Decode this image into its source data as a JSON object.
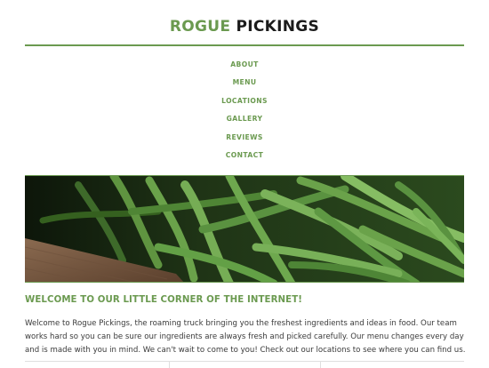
{
  "site": {
    "logo_accent": "ROGUE",
    "logo_rest": " PICKINGS",
    "accent_color": "#6b9a50"
  },
  "nav": {
    "items": [
      {
        "label": "ABOUT"
      },
      {
        "label": "MENU"
      },
      {
        "label": "LOCATIONS"
      },
      {
        "label": "GALLERY"
      },
      {
        "label": "REVIEWS"
      },
      {
        "label": "CONTACT"
      }
    ]
  },
  "hero": {
    "image_subject": "green-beans-photo"
  },
  "main": {
    "heading": "WELCOME TO OUR LITTLE CORNER OF THE INTERNET!",
    "intro_line_1": "Welcome to Rogue Pickings, the roaming truck bringing you the freshest ingredients and ideas in food. Our team",
    "intro_line_2": "works hard so you can be sure our ingredients are always fresh and picked carefully. Our menu changes every day",
    "intro_line_3": "and is made with you in mind. We can't wait to come to you! Check out our locations to see where you can find us."
  }
}
